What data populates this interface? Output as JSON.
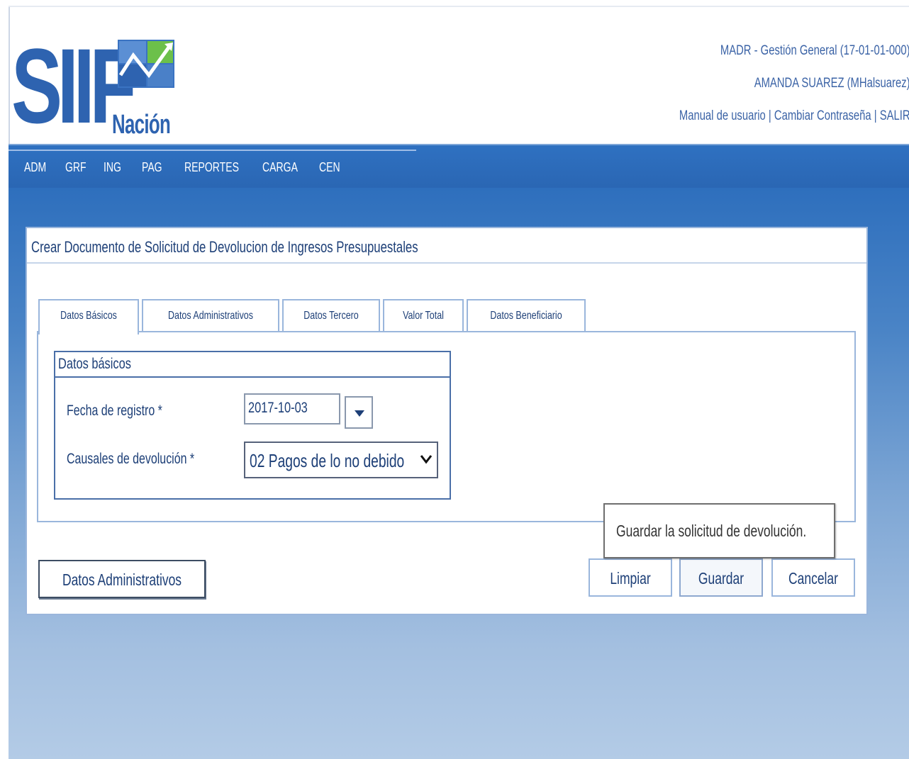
{
  "header": {
    "logo_text": "SIIF",
    "logo_subtext": "Nación",
    "entity": "MADR - Gestión General (17-01-01-000)",
    "user": "AMANDA SUAREZ (MHalsuarez)",
    "links": {
      "manual": "Manual de usuario",
      "separator": "|",
      "change_password": "Cambiar Contraseña",
      "logout": "SALIR"
    }
  },
  "nav": {
    "items": [
      "ADM",
      "GRF",
      "ING",
      "PAG",
      "REPORTES",
      "CARGA",
      "CEN"
    ]
  },
  "panel": {
    "title": "Crear Documento de Solicitud de Devolucion de Ingresos Presupuestales",
    "tabs": [
      "Datos Básicos",
      "Datos Administrativos",
      "Datos Tercero",
      "Valor Total",
      "Datos Beneficiario"
    ],
    "active_tab": "Datos Básicos",
    "fieldset": {
      "legend": "Datos básicos",
      "fecha_label": "Fecha de registro *",
      "fecha_value": "2017-10-03",
      "causales_label": "Causales de devolución *",
      "causales_value": "02 Pagos de lo no debido"
    },
    "buttons": {
      "datos_admin": "Datos Administrativos",
      "limpiar": "Limpiar",
      "guardar": "Guardar",
      "cancelar": "Cancelar"
    },
    "tooltip": "Guardar la solicitud de devolución."
  },
  "colors": {
    "brand_blue": "#2e63b0",
    "nav_blue": "#2f71c1",
    "logo_green": "#6cc04a",
    "text_dark_blue": "#1d3f77"
  }
}
